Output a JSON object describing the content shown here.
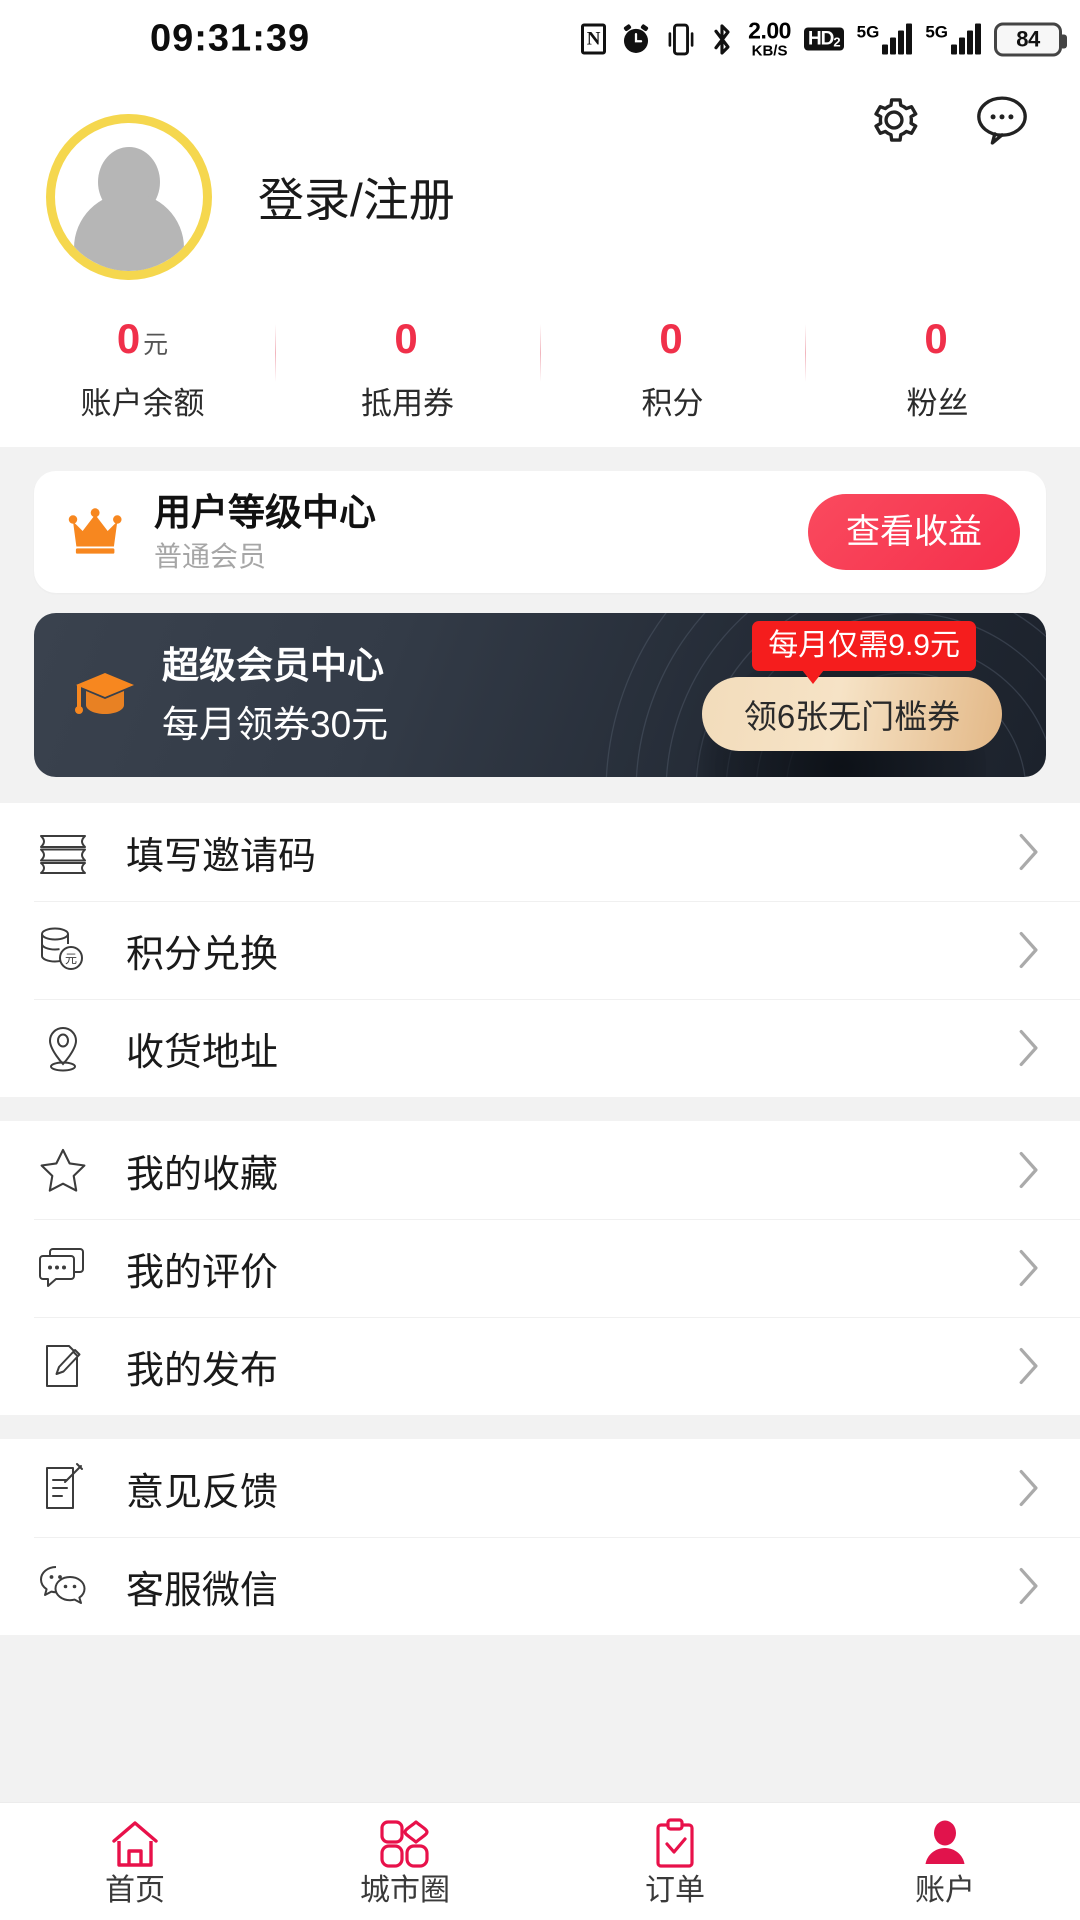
{
  "status_bar": {
    "time": "09:31:39",
    "nfc": "N",
    "net_speed_value": "2.00",
    "net_speed_unit": "KB/S",
    "hd_label": "HD",
    "hd_sub": "2",
    "signal_1_label": "5G",
    "signal_2_label": "5G",
    "battery": "84",
    "icons": [
      "nfc-icon",
      "alarm-icon",
      "vibrate-icon",
      "bluetooth-icon",
      "network-speed",
      "hd-volte-icon",
      "signal-5g-1",
      "signal-5g-2",
      "battery-icon"
    ]
  },
  "header": {
    "settings_icon": "gear-icon",
    "message_icon": "chat-bubble-icon",
    "login_text": "登录/注册",
    "avatar_ring_color": "#f5d74e"
  },
  "stats": [
    {
      "value": "0",
      "unit": "元",
      "label": "账户余额"
    },
    {
      "value": "0",
      "unit": "",
      "label": "抵用券"
    },
    {
      "value": "0",
      "unit": "",
      "label": "积分"
    },
    {
      "value": "0",
      "unit": "",
      "label": "粉丝"
    }
  ],
  "level_card": {
    "icon": "crown-icon",
    "title": "用户等级中心",
    "subtitle": "普通会员",
    "button": "查看收益",
    "button_color": "#f5304c"
  },
  "vip_card": {
    "icon": "graduation-cap-icon",
    "title": "超级会员中心",
    "subtitle": "每月领券30元",
    "button": "领6张无门槛券",
    "badge": "每月仅需9.9元",
    "badge_color": "#f51d1d",
    "button_color": "#eed3aa",
    "card_color": "#2b323d"
  },
  "menu_groups": [
    {
      "items": [
        {
          "icon": "ticket-icon",
          "label": "填写邀请码"
        },
        {
          "icon": "coin-stack-icon",
          "label": "积分兑换"
        },
        {
          "icon": "location-pin-icon",
          "label": "收货地址"
        }
      ]
    },
    {
      "items": [
        {
          "icon": "star-icon",
          "label": "我的收藏"
        },
        {
          "icon": "comment-icon",
          "label": "我的评价"
        },
        {
          "icon": "pencil-note-icon",
          "label": "我的发布"
        }
      ]
    },
    {
      "items": [
        {
          "icon": "feedback-icon",
          "label": "意见反馈"
        },
        {
          "icon": "wechat-icon",
          "label": "客服微信"
        }
      ]
    }
  ],
  "tabbar": {
    "active_color": "#e1134c",
    "inactive_color": "#e8114a",
    "items": [
      {
        "icon": "home-icon",
        "label": "首页",
        "active": false
      },
      {
        "icon": "city-circle-icon",
        "label": "城市圈",
        "active": false
      },
      {
        "icon": "clipboard-check-icon",
        "label": "订单",
        "active": false
      },
      {
        "icon": "account-person-icon",
        "label": "账户",
        "active": true
      }
    ]
  }
}
